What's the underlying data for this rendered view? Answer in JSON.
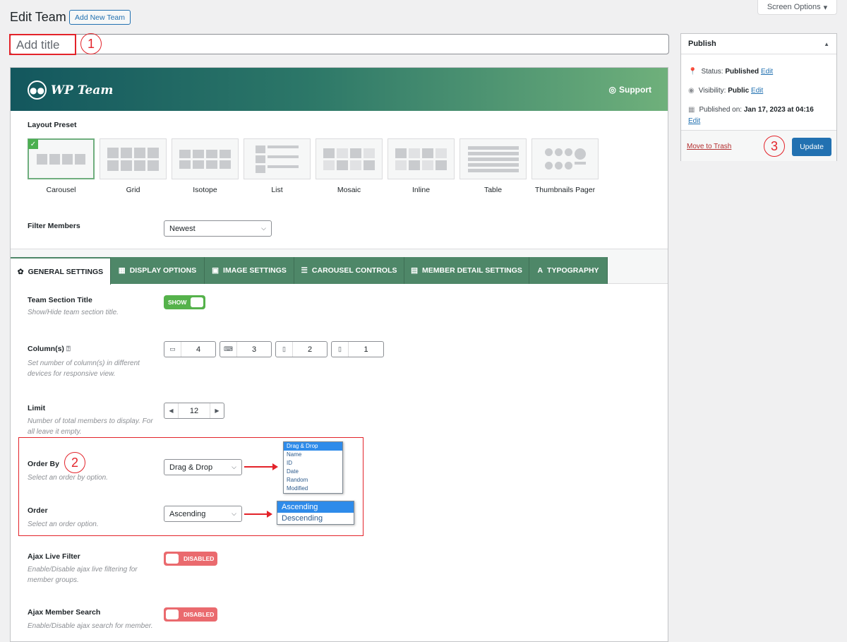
{
  "header": {
    "title": "Edit Team",
    "add_new_label": "Add New Team",
    "screen_options_label": "Screen Options"
  },
  "title_field": {
    "placeholder": "Add title"
  },
  "callouts": [
    "1",
    "2",
    "3"
  ],
  "banner": {
    "brand": "WP Team",
    "support_label": "Support"
  },
  "layout_preset": {
    "label": "Layout Preset",
    "options": [
      "Carousel",
      "Grid",
      "Isotope",
      "List",
      "Mosaic",
      "Inline",
      "Table",
      "Thumbnails Pager"
    ],
    "selected": "Carousel"
  },
  "filter_members": {
    "label": "Filter Members",
    "value": "Newest"
  },
  "tabs": [
    {
      "label": "GENERAL SETTINGS",
      "icon": "gear-icon",
      "active": true
    },
    {
      "label": "DISPLAY OPTIONS",
      "icon": "grid-icon",
      "active": false
    },
    {
      "label": "IMAGE SETTINGS",
      "icon": "image-icon",
      "active": false
    },
    {
      "label": "CAROUSEL CONTROLS",
      "icon": "sliders-icon",
      "active": false
    },
    {
      "label": "MEMBER DETAIL SETTINGS",
      "icon": "id-card-icon",
      "active": false
    },
    {
      "label": "TYPOGRAPHY",
      "icon": "font-icon",
      "active": false
    }
  ],
  "settings": {
    "section_title": {
      "label": "Team Section Title",
      "help": "Show/Hide team section title.",
      "toggle": "SHOW"
    },
    "columns": {
      "label": "Column(s)",
      "help": "Set number of column(s) in different devices for responsive view.",
      "values": [
        "4",
        "3",
        "2",
        "1"
      ]
    },
    "limit": {
      "label": "Limit",
      "help": "Number of total members to display. For all leave it empty.",
      "value": "12"
    },
    "order_by": {
      "label": "Order By",
      "help": "Select an order by option.",
      "value": "Drag & Drop",
      "options": [
        "Drag & Drop",
        "Name",
        "ID",
        "Date",
        "Random",
        "Modified"
      ]
    },
    "order": {
      "label": "Order",
      "help": "Select an order option.",
      "value": "Ascending",
      "options": [
        "Ascending",
        "Descending"
      ]
    },
    "ajax_live_filter": {
      "label": "Ajax Live Filter",
      "help": "Enable/Disable ajax live filtering for member groups.",
      "toggle": "DISABLED"
    },
    "ajax_member_search": {
      "label": "Ajax Member Search",
      "help": "Enable/Disable ajax search for member.",
      "toggle": "DISABLED"
    }
  },
  "publish": {
    "title": "Publish",
    "status_label": "Status:",
    "status_value": "Published",
    "visibility_label": "Visibility:",
    "visibility_value": "Public",
    "published_label": "Published on:",
    "published_value": "Jan 17, 2023 at 04:16",
    "edit_label": "Edit",
    "trash_label": "Move to Trash",
    "update_label": "Update"
  }
}
